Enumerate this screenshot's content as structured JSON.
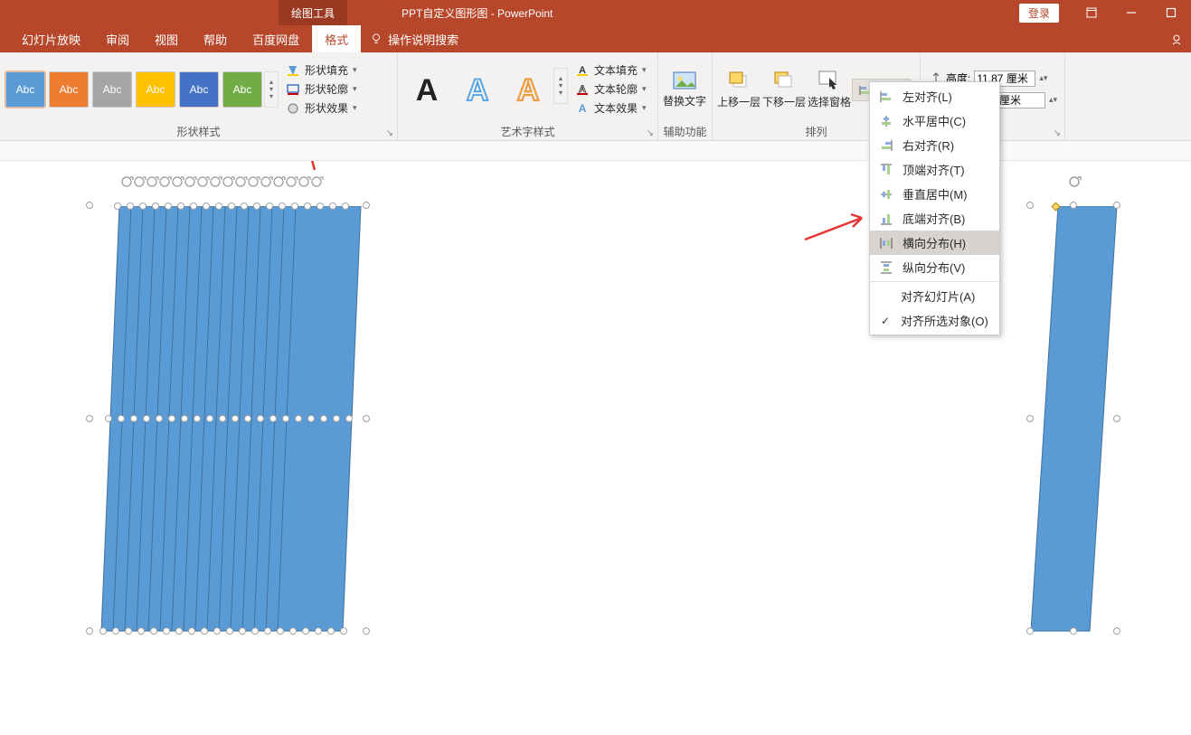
{
  "title": {
    "context_tab": "绘图工具",
    "document": "PPT自定义图形图 - PowerPoint",
    "login": "登录"
  },
  "tabs": {
    "slideshow": "幻灯片放映",
    "review": "审阅",
    "view": "视图",
    "help": "帮助",
    "baidu": "百度网盘",
    "format": "格式",
    "tell_me": "操作说明搜索"
  },
  "ribbon": {
    "swatch_label": "Abc",
    "shape_fill": "形状填充",
    "shape_outline": "形状轮廓",
    "shape_effects": "形状效果",
    "group_shape_styles": "形状样式",
    "text_fill": "文本填充",
    "text_outline": "文本轮廓",
    "text_effects": "文本效果",
    "group_wordart": "艺术字样式",
    "alt_text": "替换文字",
    "group_accessibility": "辅助功能",
    "bring_forward": "上移一层",
    "send_backward": "下移一层",
    "selection_pane": "选择窗格",
    "align": "对齐",
    "group_arrange": "排列",
    "height_label": "高度:",
    "height_value": "11.87 厘米",
    "width_value_partial": ")6 厘米"
  },
  "align_menu": {
    "left": "左对齐(L)",
    "center_h": "水平居中(C)",
    "right": "右对齐(R)",
    "top": "顶端对齐(T)",
    "middle_v": "垂直居中(M)",
    "bottom": "底端对齐(B)",
    "dist_h": "横向分布(H)",
    "dist_v": "纵向分布(V)",
    "align_slide": "对齐幻灯片(A)",
    "align_selected": "对齐所选对象(O)"
  }
}
